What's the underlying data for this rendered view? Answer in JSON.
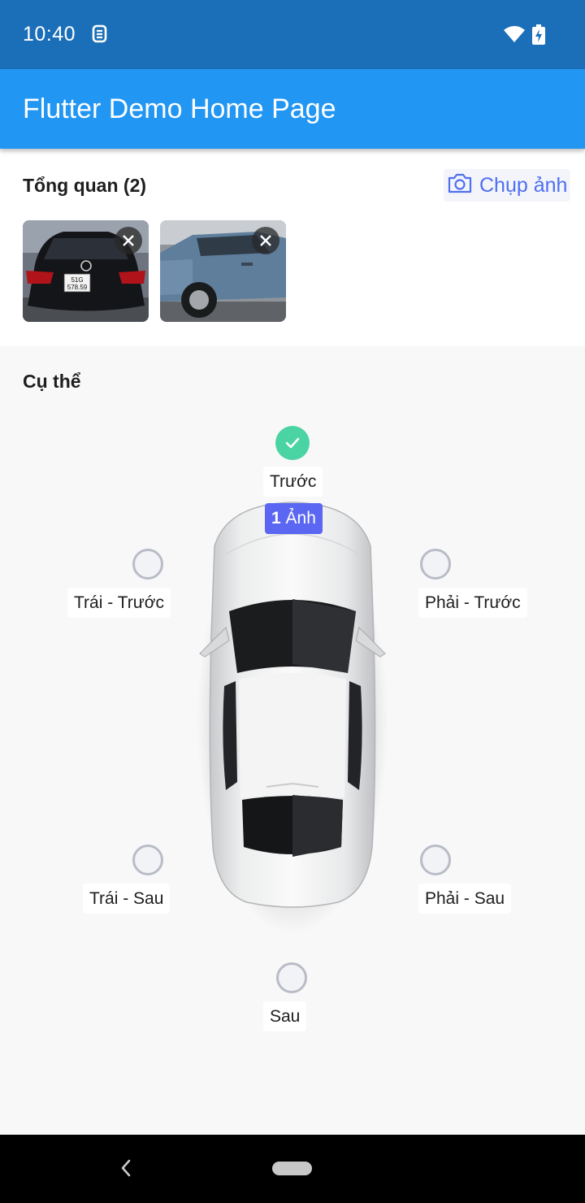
{
  "status_bar": {
    "time": "10:40",
    "icons": [
      "sim-icon",
      "wifi-icon",
      "battery-charging-icon"
    ]
  },
  "app_bar": {
    "title": "Flutter Demo Home Page"
  },
  "overview": {
    "title": "Tổng quan (2)",
    "capture_label": "Chụp ảnh",
    "capture_icon": "camera-icon",
    "photos": [
      {
        "subject": "black sedan rear view",
        "plate_line1": "51G",
        "plate_line2": "578.59"
      },
      {
        "subject": "blue SUV side view"
      }
    ]
  },
  "detail": {
    "title": "Cụ thể",
    "positions": {
      "front": {
        "label": "Trước",
        "checked": true,
        "count_number": "1",
        "count_unit": "Ảnh"
      },
      "left_front": {
        "label": "Trái - Trước",
        "checked": false
      },
      "right_front": {
        "label": "Phải - Trước",
        "checked": false
      },
      "left_rear": {
        "label": "Trái - Sau",
        "checked": false
      },
      "right_rear": {
        "label": "Phải - Sau",
        "checked": false
      },
      "rear": {
        "label": "Sau",
        "checked": false
      }
    }
  },
  "colors": {
    "status_bar": "#1b6fb8",
    "app_bar": "#2196f3",
    "accent": "#4f6ff0",
    "badge": "#5b67f2",
    "check": "#4ad3a3"
  }
}
